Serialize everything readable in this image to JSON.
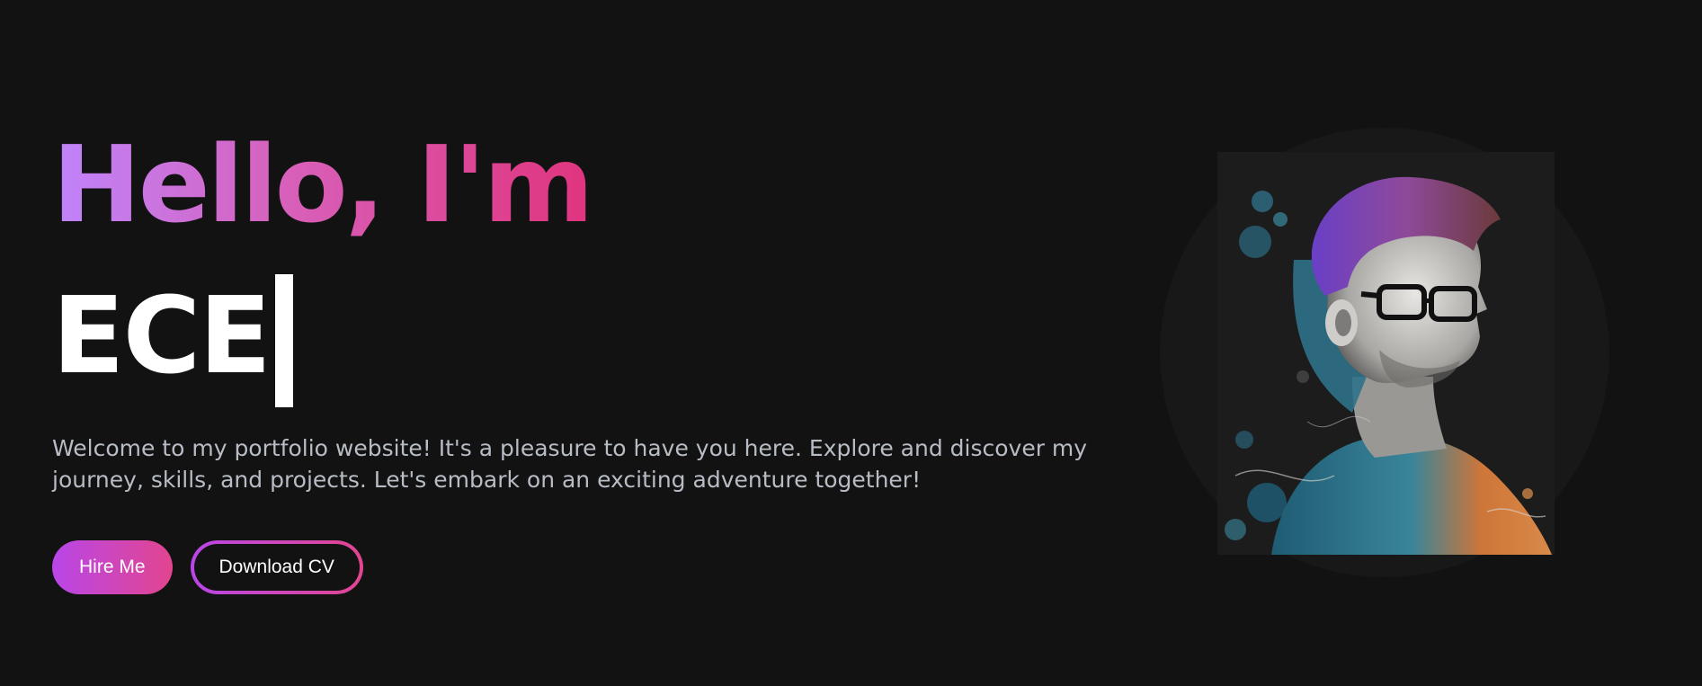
{
  "hero": {
    "greeting": "Hello, I'm",
    "role": "ECE",
    "intro": "Welcome to my portfolio website! It's a pleasure to have you here. Explore and discover my journey, skills, and projects. Let's embark on an exciting adventure together!",
    "buttons": {
      "hire_label": "Hire Me",
      "download_label": "Download CV"
    }
  },
  "colors": {
    "background": "#121212",
    "gradient_start": "#c084fc",
    "gradient_end": "#e0347e",
    "text_muted": "#b8bcc4"
  },
  "portrait": {
    "icon": "watercolor-portrait-image"
  }
}
